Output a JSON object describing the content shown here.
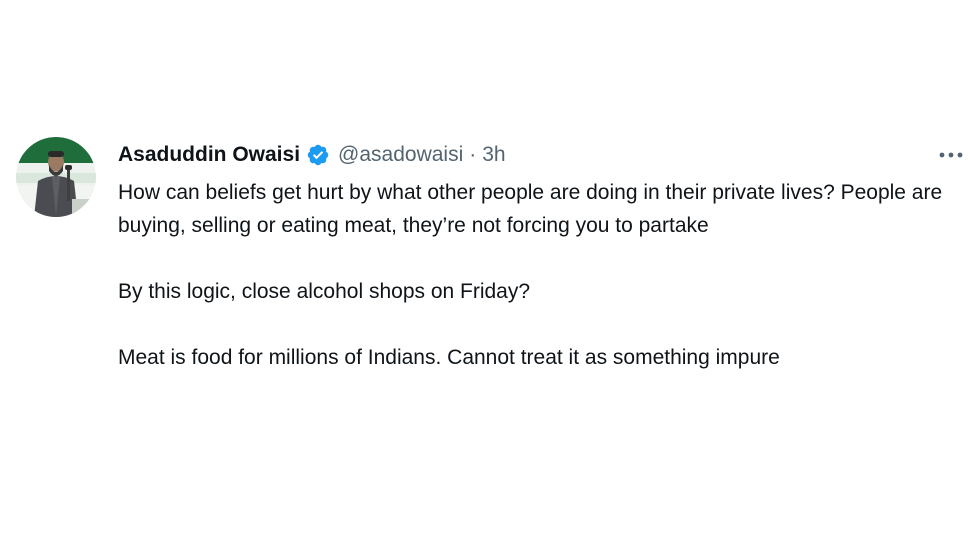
{
  "tweet": {
    "author": {
      "display_name": "Asaduddin Owaisi",
      "verified_icon": "verified-badge-icon",
      "handle": "@asadowaisi",
      "separator": "·",
      "time": "3h"
    },
    "more_icon": "more-options-icon",
    "paragraphs": [
      "How can beliefs get hurt by what other people are doing in their private lives? People are buying, selling or eating meat, they’re not forcing you to partake",
      "By this logic, close alcohol shops on Friday?",
      "Meat is food for millions of Indians. Cannot treat it as something impure"
    ]
  },
  "colors": {
    "text_primary": "#0f1419",
    "text_secondary": "#536471",
    "verified_blue": "#1d9bf0",
    "background": "#ffffff"
  }
}
